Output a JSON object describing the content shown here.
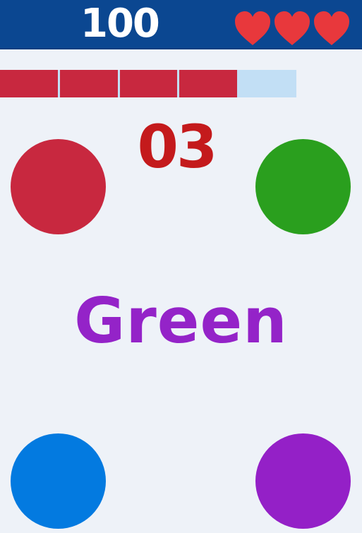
{
  "hud": {
    "score": "100",
    "lives": 3,
    "heart_color": "#e8383c"
  },
  "timer": {
    "segments_total": 5,
    "segments_remaining": 4,
    "fill_color": "#c8283f",
    "track_color": "#c2dff5"
  },
  "countdown": {
    "value": "03",
    "color": "#c41a1c"
  },
  "prompt": {
    "word": "Green",
    "ink_color": "#9423c8"
  },
  "color_buttons": [
    {
      "id": "red",
      "color": "#c8283f"
    },
    {
      "id": "green",
      "color": "#2a9f1e"
    },
    {
      "id": "blue",
      "color": "#037ae0"
    },
    {
      "id": "purple",
      "color": "#9420c7"
    }
  ]
}
